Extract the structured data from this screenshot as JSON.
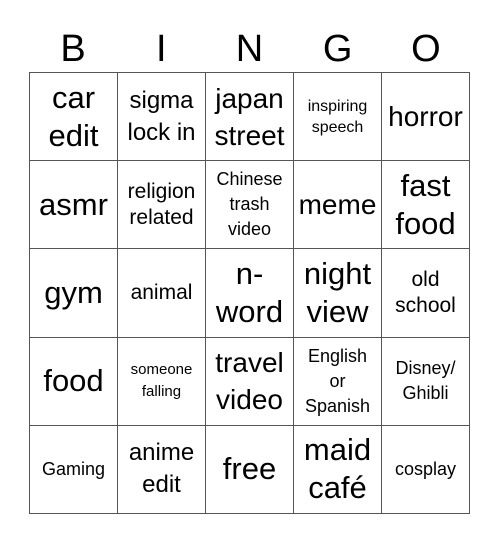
{
  "header": {
    "letters": [
      "B",
      "I",
      "N",
      "G",
      "O"
    ]
  },
  "cells": [
    {
      "text": "car\nedit",
      "size": "s-xl"
    },
    {
      "text": "sigma\nlock in",
      "size": "s-m"
    },
    {
      "text": "japan\nstreet",
      "size": "s-l"
    },
    {
      "text": "inspiring\nspeech",
      "size": "s-xs"
    },
    {
      "text": "horror",
      "size": "s-l"
    },
    {
      "text": "asmr",
      "size": "s-xl"
    },
    {
      "text": "religion\nrelated",
      "size": "s-sm"
    },
    {
      "text": "Chinese\ntrash\nvideo",
      "size": "s-s"
    },
    {
      "text": "meme",
      "size": "s-l"
    },
    {
      "text": "fast\nfood",
      "size": "s-xl"
    },
    {
      "text": "gym",
      "size": "s-xl"
    },
    {
      "text": "animal",
      "size": "s-sm"
    },
    {
      "text": "n-\nword",
      "size": "s-xl"
    },
    {
      "text": "night\nview",
      "size": "s-xl"
    },
    {
      "text": "old\nschool",
      "size": "s-sm"
    },
    {
      "text": "food",
      "size": "s-xl"
    },
    {
      "text": "someone\nfalling",
      "size": "s-xxs"
    },
    {
      "text": "travel\nvideo",
      "size": "s-l"
    },
    {
      "text": "English\nor\nSpanish",
      "size": "s-s"
    },
    {
      "text": "Disney/\nGhibli",
      "size": "s-s"
    },
    {
      "text": "Gaming",
      "size": "s-s"
    },
    {
      "text": "anime\nedit",
      "size": "s-m"
    },
    {
      "text": "free",
      "size": "s-xl"
    },
    {
      "text": "maid\ncafé",
      "size": "s-xl"
    },
    {
      "text": "cosplay",
      "size": "s-s"
    }
  ]
}
